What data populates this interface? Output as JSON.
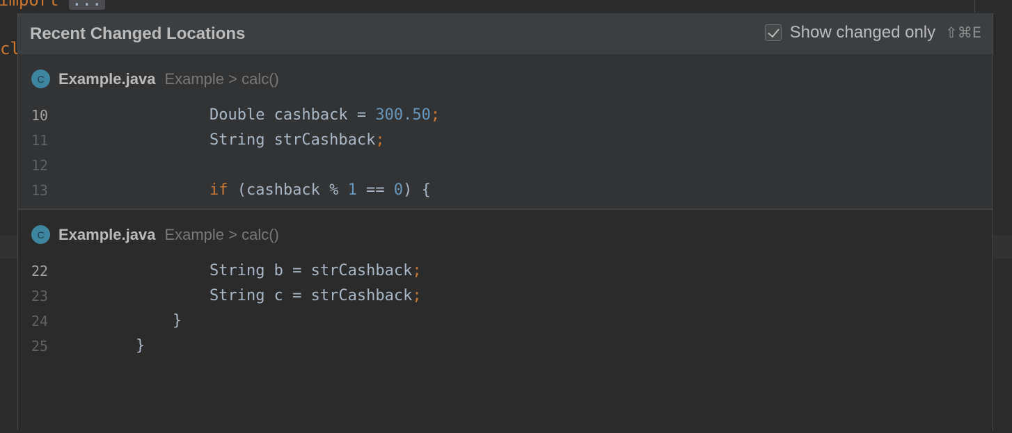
{
  "background": {
    "top_text": "import",
    "top_fold": "...",
    "left_text": "cl"
  },
  "popup": {
    "title": "Recent Changed Locations",
    "show_changed_only": {
      "label": "Show changed only",
      "checked": true,
      "shortcut": "⇧⌘E"
    }
  },
  "sections": [
    {
      "file_name": "Example.java",
      "path": "Example > calc()",
      "icon_letter": "C",
      "lines": [
        {
          "num": "10",
          "indent": "        ",
          "tokens": [
            [
              "t",
              "Double cashback = "
            ],
            [
              "n",
              "300.50"
            ],
            [
              "s",
              ";"
            ]
          ]
        },
        {
          "num": "11",
          "indent": "        ",
          "tokens": [
            [
              "t",
              "String strCashback"
            ],
            [
              "s",
              ";"
            ]
          ]
        },
        {
          "num": "12",
          "indent": "",
          "tokens": []
        },
        {
          "num": "13",
          "indent": "        ",
          "tokens": [
            [
              "k",
              "if "
            ],
            [
              "t",
              "(cashback % "
            ],
            [
              "n",
              "1"
            ],
            [
              "t",
              " == "
            ],
            [
              "n",
              "0"
            ],
            [
              "t",
              ") {"
            ]
          ]
        }
      ]
    },
    {
      "file_name": "Example.java",
      "path": "Example > calc()",
      "icon_letter": "C",
      "lines": [
        {
          "num": "22",
          "indent": "        ",
          "tokens": [
            [
              "t",
              "String b = strCashback"
            ],
            [
              "s",
              ";"
            ]
          ]
        },
        {
          "num": "23",
          "indent": "        ",
          "tokens": [
            [
              "t",
              "String c = strCashback"
            ],
            [
              "s",
              ";"
            ]
          ]
        },
        {
          "num": "24",
          "indent": "    ",
          "tokens": [
            [
              "t",
              "}"
            ]
          ]
        },
        {
          "num": "25",
          "indent": "",
          "tokens": [
            [
              "t",
              "}"
            ]
          ]
        }
      ]
    }
  ],
  "colors": {
    "keyword": "#cc7832",
    "number": "#6897bb",
    "text": "#a9b7c6",
    "icon": "#3e86a0"
  }
}
